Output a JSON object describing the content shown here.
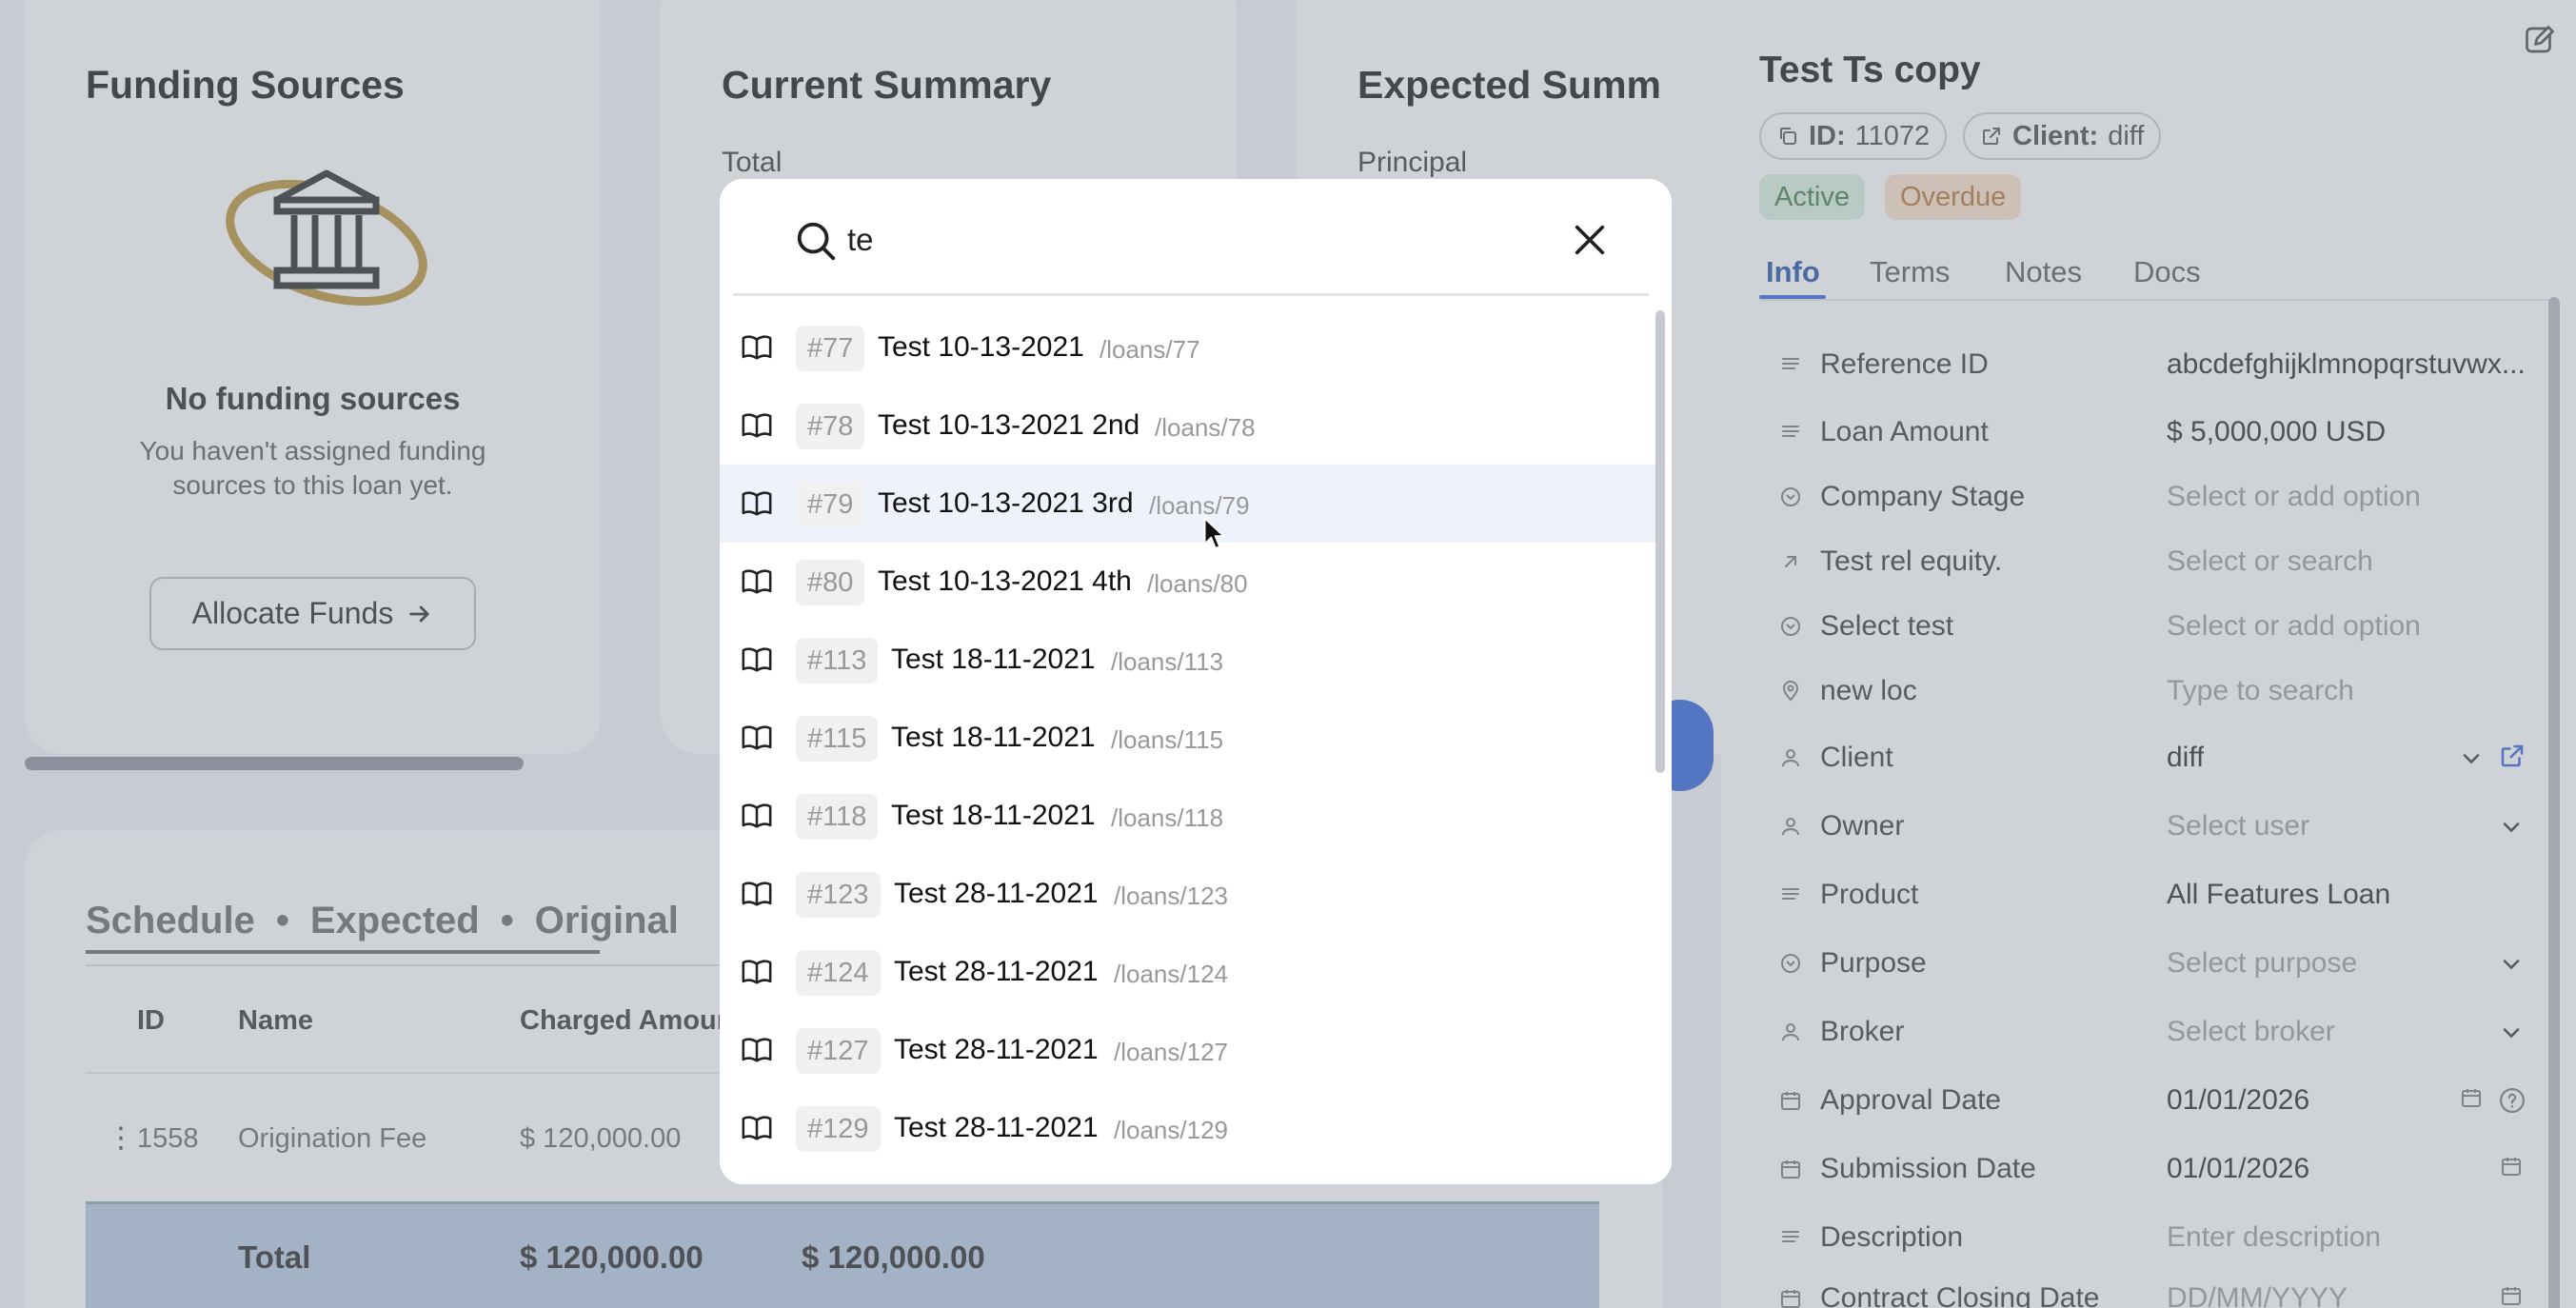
{
  "funding": {
    "title": "Funding Sources",
    "empty_title": "No funding sources",
    "empty_sub": "You haven't assigned funding sources to this loan yet.",
    "allocate_label": "Allocate Funds"
  },
  "current_summary": {
    "title": "Current Summary",
    "first_label": "Total"
  },
  "expected_summary": {
    "title": "Expected Summ",
    "first_label": "Principal"
  },
  "schedule": {
    "tabs": [
      "Schedule",
      "Expected",
      "Original"
    ],
    "columns": [
      "ID",
      "Name",
      "Charged Amour"
    ],
    "row": {
      "id": "1558",
      "name": "Origination Fee",
      "charged": "$ 120,000.00"
    },
    "total": {
      "label": "Total",
      "charged": "$ 120,000.00",
      "second": "$ 120,000.00"
    }
  },
  "panel": {
    "title": "Test Ts copy",
    "id_chip": {
      "label": "ID:",
      "value": "11072"
    },
    "client_chip": {
      "label": "Client:",
      "value": "diff"
    },
    "badges": {
      "active": "Active",
      "overdue": "Overdue"
    },
    "tabs": [
      "Info",
      "Terms",
      "Notes",
      "Docs"
    ],
    "fields": [
      {
        "label": "Reference ID",
        "value": "abcdefghijklmnopqrstuvwx...",
        "placeholder": false,
        "icon": "lines-icon"
      },
      {
        "label": "Loan Amount",
        "value": "$ 5,000,000 USD",
        "placeholder": false,
        "icon": "lines-icon"
      },
      {
        "label": "Company Stage",
        "value": "Select or add option",
        "placeholder": true,
        "icon": "dropdown-circle-icon"
      },
      {
        "label": "Test rel equity.",
        "value": "Select or search",
        "placeholder": true,
        "icon": "arrow-up-right-icon"
      },
      {
        "label": "Select test",
        "value": "Select or add option",
        "placeholder": true,
        "icon": "dropdown-circle-icon"
      },
      {
        "label": "new loc",
        "value": "Type to search",
        "placeholder": true,
        "icon": "location-pin-icon"
      },
      {
        "label": "Client",
        "value": "diff",
        "placeholder": false,
        "icon": "user-icon"
      },
      {
        "label": "Owner",
        "value": "Select user",
        "placeholder": true,
        "icon": "user-icon"
      },
      {
        "label": "Product",
        "value": "All Features Loan",
        "placeholder": false,
        "icon": "lines-icon"
      },
      {
        "label": "Purpose",
        "value": "Select purpose",
        "placeholder": true,
        "icon": "dropdown-circle-icon"
      },
      {
        "label": "Broker",
        "value": "Select broker",
        "placeholder": true,
        "icon": "user-icon"
      },
      {
        "label": "Approval Date",
        "value": "01/01/2026",
        "placeholder": false,
        "icon": "calendar-icon"
      },
      {
        "label": "Submission Date",
        "value": "01/01/2026",
        "placeholder": false,
        "icon": "calendar-icon"
      },
      {
        "label": "Description",
        "value": "Enter description",
        "placeholder": true,
        "icon": "lines-icon"
      },
      {
        "label": "Contract Closing Date",
        "value": "DD/MM/YYYY",
        "placeholder": true,
        "icon": "calendar-icon"
      }
    ]
  },
  "search": {
    "query": "te",
    "results": [
      {
        "num": "#77",
        "title": "Test 10-13-2021",
        "path": "/loans/77"
      },
      {
        "num": "#78",
        "title": "Test 10-13-2021 2nd",
        "path": "/loans/78"
      },
      {
        "num": "#79",
        "title": "Test 10-13-2021 3rd",
        "path": "/loans/79",
        "highlighted": true
      },
      {
        "num": "#80",
        "title": "Test 10-13-2021 4th",
        "path": "/loans/80"
      },
      {
        "num": "#113",
        "title": "Test 18-11-2021",
        "path": "/loans/113"
      },
      {
        "num": "#115",
        "title": "Test 18-11-2021",
        "path": "/loans/115"
      },
      {
        "num": "#118",
        "title": "Test 18-11-2021",
        "path": "/loans/118"
      },
      {
        "num": "#123",
        "title": "Test 28-11-2021",
        "path": "/loans/123"
      },
      {
        "num": "#124",
        "title": "Test 28-11-2021",
        "path": "/loans/124"
      },
      {
        "num": "#127",
        "title": "Test 28-11-2021",
        "path": "/loans/127"
      },
      {
        "num": "#129",
        "title": "Test 28-11-2021",
        "path": "/loans/129"
      }
    ]
  },
  "colors": {
    "accent": "#2b5fd9",
    "active_bg": "#d9f0dd",
    "overdue_bg": "#fbe2c9",
    "highlight": "#eef2fa"
  }
}
